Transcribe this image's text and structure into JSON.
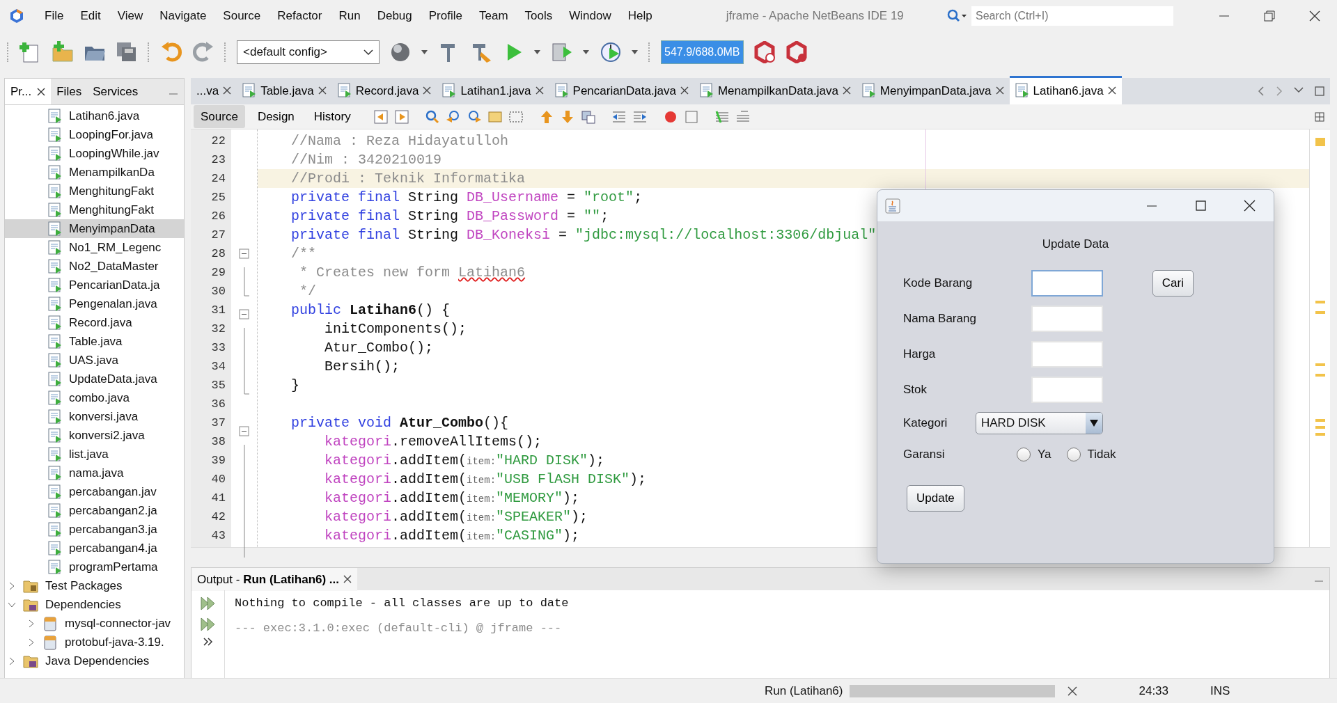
{
  "window": {
    "title": "jframe - Apache NetBeans IDE 19"
  },
  "menu": [
    "File",
    "Edit",
    "View",
    "Navigate",
    "Source",
    "Refactor",
    "Run",
    "Debug",
    "Profile",
    "Team",
    "Tools",
    "Window",
    "Help"
  ],
  "search": {
    "placeholder": "Search (Ctrl+I)"
  },
  "toolbar": {
    "config": "<default config>",
    "memory": "547.9/688.0MB"
  },
  "side_tabs": [
    {
      "label": "Pr...",
      "selected": true,
      "closable": true
    },
    {
      "label": "Files",
      "selected": false,
      "closable": false
    },
    {
      "label": "Services",
      "selected": false,
      "closable": false
    }
  ],
  "tree": {
    "files": [
      {
        "label": "Latihan6.java",
        "selected": false
      },
      {
        "label": "LoopingFor.java",
        "selected": false
      },
      {
        "label": "LoopingWhile.jav",
        "selected": false
      },
      {
        "label": "MenampilkanDa",
        "selected": false
      },
      {
        "label": "MenghitungFakt",
        "selected": false
      },
      {
        "label": "MenghitungFakt",
        "selected": false
      },
      {
        "label": "MenyimpanData",
        "selected": true
      },
      {
        "label": "No1_RM_Legenc",
        "selected": false
      },
      {
        "label": "No2_DataMaster",
        "selected": false
      },
      {
        "label": "PencarianData.ja",
        "selected": false
      },
      {
        "label": "Pengenalan.java",
        "selected": false
      },
      {
        "label": "Record.java",
        "selected": false
      },
      {
        "label": "Table.java",
        "selected": false
      },
      {
        "label": "UAS.java",
        "selected": false
      },
      {
        "label": "UpdateData.java",
        "selected": false
      },
      {
        "label": "combo.java",
        "selected": false
      },
      {
        "label": "konversi.java",
        "selected": false
      },
      {
        "label": "konversi2.java",
        "selected": false
      },
      {
        "label": "list.java",
        "selected": false
      },
      {
        "label": "nama.java",
        "selected": false
      },
      {
        "label": "percabangan.jav",
        "selected": false
      },
      {
        "label": "percabangan2.ja",
        "selected": false
      },
      {
        "label": "percabangan3.ja",
        "selected": false
      },
      {
        "label": "percabangan4.ja",
        "selected": false
      },
      {
        "label": "programPertama",
        "selected": false
      }
    ],
    "nodes": [
      {
        "label": "Test Packages",
        "kind": "package",
        "expanded": false
      },
      {
        "label": "Dependencies",
        "kind": "library",
        "expanded": true,
        "children": [
          {
            "label": "mysql-connector-jav",
            "kind": "jar",
            "expanded": false
          },
          {
            "label": "protobuf-java-3.19.",
            "kind": "jar",
            "expanded": false
          }
        ]
      },
      {
        "label": "Java Dependencies",
        "kind": "library",
        "expanded": false
      }
    ]
  },
  "editor_tabs": [
    {
      "label": "...va",
      "selected": false,
      "icon": false
    },
    {
      "label": "Table.java",
      "selected": false,
      "icon": true
    },
    {
      "label": "Record.java",
      "selected": false,
      "icon": true
    },
    {
      "label": "Latihan1.java",
      "selected": false,
      "icon": true
    },
    {
      "label": "PencarianData.java",
      "selected": false,
      "icon": true
    },
    {
      "label": "MenampilkanData.java",
      "selected": false,
      "icon": true
    },
    {
      "label": "MenyimpanData.java",
      "selected": false,
      "icon": true
    },
    {
      "label": "Latihan6.java",
      "selected": true,
      "icon": true
    }
  ],
  "view_tabs": [
    {
      "label": "Source",
      "selected": true
    },
    {
      "label": "Design",
      "selected": false
    },
    {
      "label": "History",
      "selected": false
    }
  ],
  "code": [
    {
      "number": "22",
      "current": false,
      "tokens": [
        {
          "kind": "comment",
          "text": "    //Nama : Reza Hidayatulloh"
        }
      ]
    },
    {
      "number": "23",
      "current": false,
      "tokens": [
        {
          "kind": "comment",
          "text": "    //Nim : 3420210019"
        }
      ]
    },
    {
      "number": "24",
      "current": true,
      "tokens": [
        {
          "kind": "comment",
          "text": "    //Prodi : Teknik Informatika"
        }
      ]
    },
    {
      "number": "25",
      "current": false,
      "tokens": [
        {
          "kind": "keyword",
          "text": "    private final "
        },
        {
          "kind": "plain",
          "text": "String "
        },
        {
          "kind": "field",
          "text": "DB_Username"
        },
        {
          "kind": "plain",
          "text": " = "
        },
        {
          "kind": "string",
          "text": "\"root\""
        },
        {
          "kind": "plain",
          "text": ";"
        }
      ]
    },
    {
      "number": "26",
      "current": false,
      "tokens": [
        {
          "kind": "keyword",
          "text": "    private final "
        },
        {
          "kind": "plain",
          "text": "String "
        },
        {
          "kind": "field",
          "text": "DB_Password"
        },
        {
          "kind": "plain",
          "text": " = "
        },
        {
          "kind": "string",
          "text": "\"\""
        },
        {
          "kind": "plain",
          "text": ";"
        }
      ]
    },
    {
      "number": "27",
      "current": false,
      "tokens": [
        {
          "kind": "keyword",
          "text": "    private final "
        },
        {
          "kind": "plain",
          "text": "String "
        },
        {
          "kind": "field",
          "text": "DB_Koneksi"
        },
        {
          "kind": "plain",
          "text": " = "
        },
        {
          "kind": "string",
          "text": "\"jdbc:mysql://localhost:3306/dbjual\""
        }
      ]
    },
    {
      "number": "28",
      "current": false,
      "kind": "start",
      "tokens": [
        {
          "kind": "comment",
          "text": "    /**"
        }
      ]
    },
    {
      "number": "29",
      "current": false,
      "kind": "mid",
      "tokens": [
        {
          "kind": "comment",
          "text": "     * Creates new form "
        },
        {
          "kind": "misspelled",
          "text": "Latihan6"
        }
      ]
    },
    {
      "number": "30",
      "current": false,
      "kind": "end",
      "tokens": [
        {
          "kind": "comment",
          "text": "     */"
        }
      ]
    },
    {
      "number": "31",
      "current": false,
      "kind": "start",
      "tokens": [
        {
          "kind": "keyword",
          "text": "    public "
        },
        {
          "kind": "bold",
          "text": "Latihan6"
        },
        {
          "kind": "plain",
          "text": "() {"
        }
      ]
    },
    {
      "number": "32",
      "current": false,
      "kind": "mid",
      "tokens": [
        {
          "kind": "plain",
          "text": "        initComponents();"
        }
      ]
    },
    {
      "number": "33",
      "current": false,
      "kind": "mid",
      "tokens": [
        {
          "kind": "plain",
          "text": "        Atur_Combo();"
        }
      ]
    },
    {
      "number": "34",
      "current": false,
      "kind": "mid",
      "tokens": [
        {
          "kind": "plain",
          "text": "        Bersih();"
        }
      ]
    },
    {
      "number": "35",
      "current": false,
      "kind": "end",
      "tokens": [
        {
          "kind": "plain",
          "text": "    }"
        }
      ]
    },
    {
      "number": "36",
      "current": false
    },
    {
      "number": "37",
      "current": false,
      "kind": "start",
      "tokens": [
        {
          "kind": "keyword",
          "text": "    private void "
        },
        {
          "kind": "bold",
          "text": "Atur_Combo"
        },
        {
          "kind": "plain",
          "text": "(){"
        }
      ]
    },
    {
      "number": "38",
      "current": false,
      "kind": "mid",
      "tokens": [
        {
          "kind": "field",
          "text": "        kategori"
        },
        {
          "kind": "plain",
          "text": ".removeAllItems();"
        }
      ]
    },
    {
      "number": "39",
      "current": false,
      "kind": "mid",
      "tokens": [
        {
          "kind": "field",
          "text": "        kategori"
        },
        {
          "kind": "plain",
          "text": ".addItem("
        },
        {
          "kind": "hint",
          "text": "item:"
        },
        {
          "kind": "string",
          "text": "\"HARD DISK\""
        },
        {
          "kind": "plain",
          "text": ");"
        }
      ]
    },
    {
      "number": "40",
      "current": false,
      "kind": "mid",
      "tokens": [
        {
          "kind": "field",
          "text": "        kategori"
        },
        {
          "kind": "plain",
          "text": ".addItem("
        },
        {
          "kind": "hint",
          "text": "item:"
        },
        {
          "kind": "string",
          "text": "\"USB FlASH DISK\""
        },
        {
          "kind": "plain",
          "text": ");"
        }
      ]
    },
    {
      "number": "41",
      "current": false,
      "kind": "mid",
      "tokens": [
        {
          "kind": "field",
          "text": "        kategori"
        },
        {
          "kind": "plain",
          "text": ".addItem("
        },
        {
          "kind": "hint",
          "text": "item:"
        },
        {
          "kind": "string",
          "text": "\"MEMORY\""
        },
        {
          "kind": "plain",
          "text": ");"
        }
      ]
    },
    {
      "number": "42",
      "current": false,
      "kind": "mid",
      "tokens": [
        {
          "kind": "field",
          "text": "        kategori"
        },
        {
          "kind": "plain",
          "text": ".addItem("
        },
        {
          "kind": "hint",
          "text": "item:"
        },
        {
          "kind": "string",
          "text": "\"SPEAKER\""
        },
        {
          "kind": "plain",
          "text": ");"
        }
      ]
    },
    {
      "number": "43",
      "current": false,
      "kind": "mid",
      "tokens": [
        {
          "kind": "field",
          "text": "        kategori"
        },
        {
          "kind": "plain",
          "text": ".addItem("
        },
        {
          "kind": "hint",
          "text": "item:"
        },
        {
          "kind": "string",
          "text": "\"CASING\""
        },
        {
          "kind": "plain",
          "text": ");"
        }
      ]
    }
  ],
  "output": {
    "title": "Output - **Run (Latihan6) ...**",
    "lines": [
      {
        "kind": "info",
        "text": "Nothing to compile - all classes are up to date"
      },
      {
        "kind": "muted",
        "text": "--- exec:3.1.0:exec (default-cli) @ jframe ---"
      }
    ]
  },
  "status_bar": {
    "task": "Run (Latihan6)",
    "level": 1,
    "position": "24:33",
    "mode": "INS"
  },
  "dialog": {
    "heading": "Update Data",
    "fields": [
      {
        "label": "Kode Barang",
        "focused": true
      },
      {
        "label": "Nama Barang",
        "focused": false
      },
      {
        "label": "Harga",
        "focused": false
      },
      {
        "label": "Stok",
        "focused": false
      }
    ],
    "search_button": "Cari",
    "category": {
      "label": "Kategori",
      "value": "HARD DISK"
    },
    "warranty": {
      "label": "Garansi",
      "options": [
        {
          "label": "Ya",
          "selected": false
        },
        {
          "label": "Tidak",
          "selected": false
        }
      ]
    },
    "submit": "Update"
  }
}
